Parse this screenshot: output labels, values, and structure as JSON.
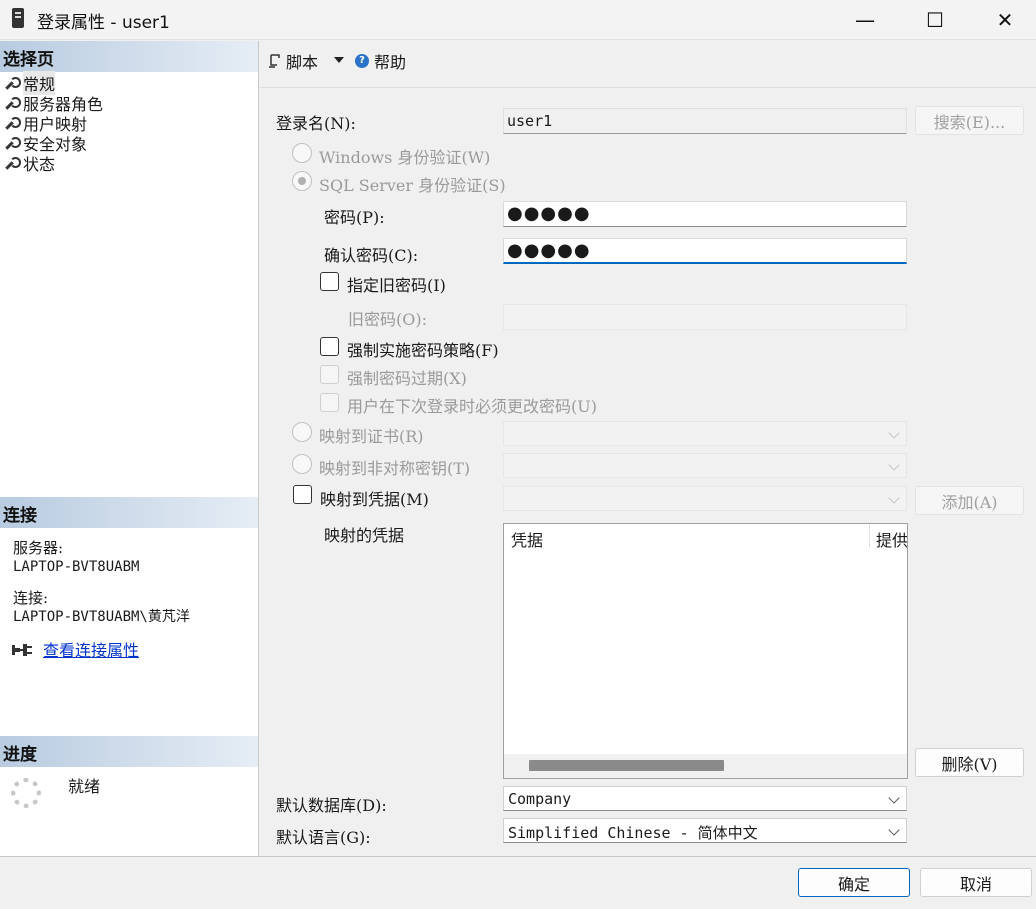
{
  "window": {
    "title": "登录属性 - user1",
    "minimize_symbol": "—",
    "maximize_symbol": "☐",
    "close_symbol": "✕"
  },
  "left": {
    "select_page_header": "选择页",
    "nav_items": [
      {
        "label": "常规",
        "selected": true
      },
      {
        "label": "服务器角色",
        "selected": false
      },
      {
        "label": "用户映射",
        "selected": false
      },
      {
        "label": "安全对象",
        "selected": false
      },
      {
        "label": "状态",
        "selected": false
      }
    ],
    "connection_header": "连接",
    "server_label": "服务器:",
    "server_value": "LAPTOP-BVT8UABM",
    "connection_label": "连接:",
    "connection_value": "LAPTOP-BVT8UABM\\黄芃洋",
    "view_conn_props": "查看连接属性",
    "progress_header": "进度",
    "progress_status": "就绪"
  },
  "toolbar": {
    "script_label": "脚本",
    "help_label": "帮助",
    "help_glyph": "?"
  },
  "form": {
    "login_name_label": "登录名(N):",
    "login_name_value": "user1",
    "search_button": "搜索(E)...",
    "windows_auth": "Windows 身份验证(W)",
    "sql_auth": "SQL Server 身份验证(S)",
    "password_label": "密码(P):",
    "password_value": "●●●●●",
    "confirm_label": "确认密码(C):",
    "confirm_value": "●●●●●",
    "specify_old_password": "指定旧密码(I)",
    "old_password_label": "旧密码(O):",
    "enforce_policy": "强制实施密码策略(F)",
    "enforce_expiration": "强制密码过期(X)",
    "must_change": "用户在下次登录时必须更改密码(U)",
    "map_to_cert": "映射到证书(R)",
    "map_to_asym": "映射到非对称密钥(T)",
    "map_to_cred": "映射到凭据(M)",
    "add_button": "添加(A)",
    "mapped_creds_label": "映射的凭据",
    "cred_columns": [
      "凭据",
      "提供"
    ],
    "remove_button": "删除(V)",
    "default_db_label": "默认数据库(D):",
    "default_db_value": "Company",
    "default_lang_label": "默认语言(G):",
    "default_lang_value": "Simplified Chinese - 简体中文"
  },
  "footer": {
    "ok_button": "确定",
    "cancel_button": "取消"
  }
}
